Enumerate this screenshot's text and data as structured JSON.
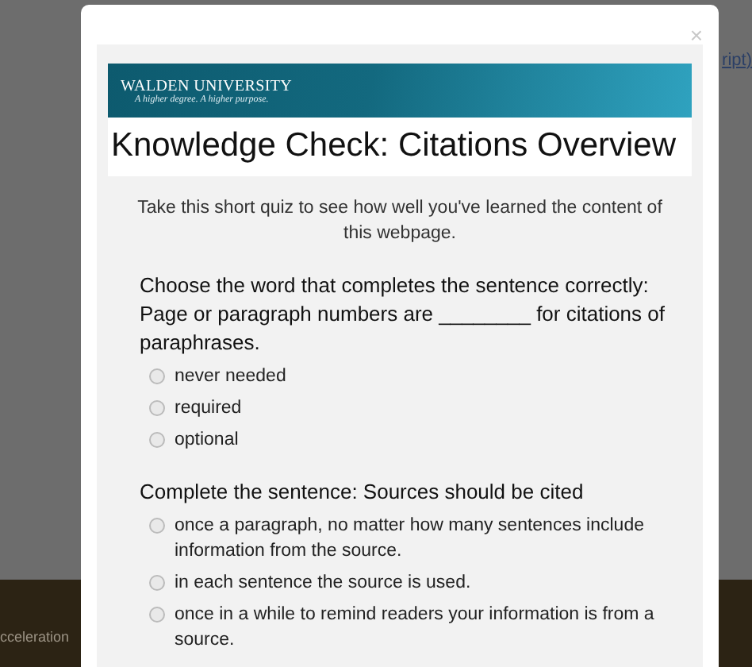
{
  "background": {
    "side_text": "ript)",
    "footer_text": "cceleration"
  },
  "modal": {
    "close": "×",
    "banner": {
      "name": "WALDEN UNIVERSITY",
      "tagline": "A higher degree. A higher purpose."
    },
    "title": "Knowledge Check: Citations Overview",
    "intro": "Take this short quiz to see how well you've learned the content of this webpage.",
    "questions": [
      {
        "prompt": "Choose the word that completes the sentence correctly: Page or paragraph numbers are ________ for citations of paraphrases.",
        "options": [
          {
            "label": "never needed",
            "selected": false
          },
          {
            "label": "required",
            "selected": false
          },
          {
            "label": "optional",
            "selected": false
          }
        ]
      },
      {
        "prompt": "Complete the sentence: Sources should be cited",
        "options": [
          {
            "label": "once a paragraph, no matter how many sentences include information from the source.",
            "selected": false
          },
          {
            "label": "in each sentence the source is used.",
            "selected": false
          },
          {
            "label": "once in a while to remind readers your information is from a source.",
            "selected": false
          }
        ]
      }
    ]
  }
}
